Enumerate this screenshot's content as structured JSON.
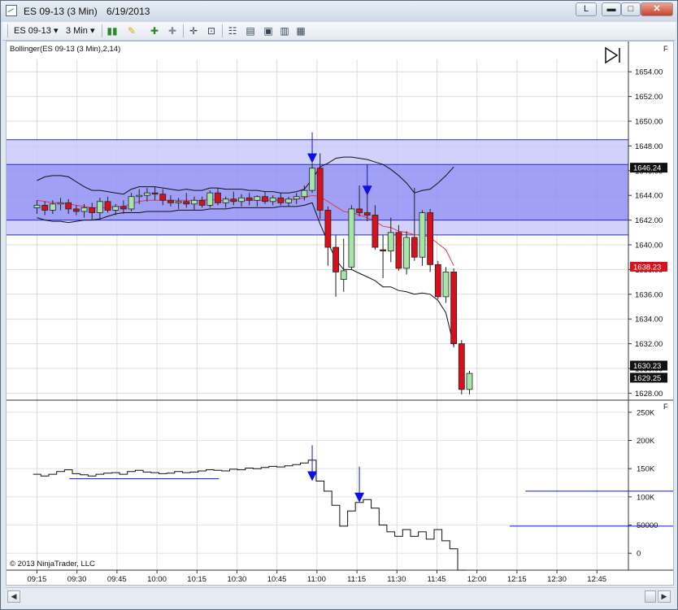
{
  "window": {
    "title_symbol": "ES 09-13 (3 Min)",
    "title_date": "6/19/2013",
    "btn_link": "L",
    "btn_min": "▬",
    "btn_max": "□",
    "btn_close": "✕"
  },
  "toolbar": {
    "instrument": "ES 09-13",
    "interval": "3 Min"
  },
  "chart": {
    "indicator_label": "Bollinger(ES 09-13 (3 Min),2,14)",
    "copyright": "© 2013 NinjaTrader, LLC",
    "colors": {
      "zone_fill": "#8f8ff5",
      "zone_fill_light": "#c9c9fb",
      "zone_line": "#2a2acf",
      "band": "#111111",
      "mid": "#e03a4a",
      "up": "#a8e3a8",
      "down": "#d8101c",
      "arrow": "#1010e0",
      "last_price_bg": "#d8101c",
      "marker_bg": "#111111"
    },
    "price_markers": [
      {
        "label": "1646.24",
        "value": 1646.24,
        "bg": "#111111"
      },
      {
        "label": "1638.23",
        "value": 1638.23,
        "bg": "#d8101c"
      },
      {
        "label": "1630.23",
        "value": 1630.23,
        "bg": "#111111"
      },
      {
        "label": "1629.25",
        "value": 1629.25,
        "bg": "#111111"
      }
    ]
  },
  "chart_data": {
    "type": "candlestick",
    "y_ticks": [
      "1654.00",
      "1652.00",
      "1650.00",
      "1648.00",
      "1646.00",
      "1644.00",
      "1642.00",
      "1640.00",
      "1638.00",
      "1636.00",
      "1634.00",
      "1632.00",
      "1630.00",
      "1628.00"
    ],
    "ylim": [
      1627.5,
      1655
    ],
    "x_ticks": [
      "09:15",
      "09:30",
      "09:45",
      "10:00",
      "10:15",
      "10:30",
      "10:45",
      "11:00",
      "11:15",
      "11:30",
      "11:45",
      "12:00",
      "12:15",
      "12:30",
      "12:45"
    ],
    "zones": [
      {
        "from": 1646.5,
        "to": 1648.5
      },
      {
        "from": 1642.0,
        "to": 1646.5,
        "dark": true
      },
      {
        "from": 1640.8,
        "to": 1642.0
      }
    ],
    "zone_lines": [
      1648.5,
      1646.5,
      1642.0,
      1640.8
    ],
    "candles": [
      {
        "o": 1643.0,
        "h": 1643.6,
        "l": 1642.5,
        "c": 1643.2
      },
      {
        "o": 1643.2,
        "h": 1643.5,
        "l": 1642.4,
        "c": 1642.8
      },
      {
        "o": 1642.8,
        "h": 1643.6,
        "l": 1642.5,
        "c": 1643.3
      },
      {
        "o": 1643.3,
        "h": 1643.8,
        "l": 1642.8,
        "c": 1643.4
      },
      {
        "o": 1643.4,
        "h": 1643.7,
        "l": 1642.5,
        "c": 1642.9
      },
      {
        "o": 1642.9,
        "h": 1643.2,
        "l": 1642.4,
        "c": 1642.7
      },
      {
        "o": 1642.7,
        "h": 1643.3,
        "l": 1642.2,
        "c": 1643.0
      },
      {
        "o": 1643.0,
        "h": 1643.4,
        "l": 1642.0,
        "c": 1642.6
      },
      {
        "o": 1642.6,
        "h": 1643.8,
        "l": 1642.0,
        "c": 1643.5
      },
      {
        "o": 1643.5,
        "h": 1643.9,
        "l": 1642.6,
        "c": 1642.8
      },
      {
        "o": 1642.8,
        "h": 1643.3,
        "l": 1642.4,
        "c": 1643.1
      },
      {
        "o": 1643.1,
        "h": 1643.6,
        "l": 1642.5,
        "c": 1642.9
      },
      {
        "o": 1642.9,
        "h": 1644.2,
        "l": 1642.7,
        "c": 1643.9
      },
      {
        "o": 1643.9,
        "h": 1644.5,
        "l": 1643.3,
        "c": 1644.0
      },
      {
        "o": 1644.0,
        "h": 1644.6,
        "l": 1643.5,
        "c": 1644.2
      },
      {
        "o": 1644.2,
        "h": 1644.7,
        "l": 1643.6,
        "c": 1644.1
      },
      {
        "o": 1644.1,
        "h": 1644.5,
        "l": 1643.2,
        "c": 1643.6
      },
      {
        "o": 1643.6,
        "h": 1644.0,
        "l": 1643.1,
        "c": 1643.4
      },
      {
        "o": 1643.4,
        "h": 1643.8,
        "l": 1642.9,
        "c": 1643.5
      },
      {
        "o": 1643.5,
        "h": 1644.2,
        "l": 1643.0,
        "c": 1643.3
      },
      {
        "o": 1643.3,
        "h": 1643.9,
        "l": 1642.8,
        "c": 1643.6
      },
      {
        "o": 1643.6,
        "h": 1643.9,
        "l": 1643.0,
        "c": 1643.2
      },
      {
        "o": 1643.2,
        "h": 1644.4,
        "l": 1643.0,
        "c": 1644.2
      },
      {
        "o": 1644.2,
        "h": 1644.6,
        "l": 1643.2,
        "c": 1643.4
      },
      {
        "o": 1643.4,
        "h": 1643.9,
        "l": 1643.0,
        "c": 1643.7
      },
      {
        "o": 1643.7,
        "h": 1644.3,
        "l": 1643.2,
        "c": 1643.5
      },
      {
        "o": 1643.5,
        "h": 1644.1,
        "l": 1643.1,
        "c": 1643.8
      },
      {
        "o": 1643.8,
        "h": 1644.2,
        "l": 1643.2,
        "c": 1643.6
      },
      {
        "o": 1643.6,
        "h": 1644.0,
        "l": 1643.1,
        "c": 1643.9
      },
      {
        "o": 1643.9,
        "h": 1644.3,
        "l": 1643.3,
        "c": 1643.5
      },
      {
        "o": 1643.5,
        "h": 1644.0,
        "l": 1643.2,
        "c": 1643.8
      },
      {
        "o": 1643.8,
        "h": 1644.2,
        "l": 1643.2,
        "c": 1643.4
      },
      {
        "o": 1643.4,
        "h": 1643.9,
        "l": 1643.1,
        "c": 1643.7
      },
      {
        "o": 1643.7,
        "h": 1644.2,
        "l": 1643.3,
        "c": 1643.9
      },
      {
        "o": 1643.9,
        "h": 1644.8,
        "l": 1643.6,
        "c": 1644.4
      },
      {
        "o": 1644.4,
        "h": 1646.6,
        "l": 1644.2,
        "c": 1646.2
      },
      {
        "o": 1646.2,
        "h": 1647.4,
        "l": 1642.1,
        "c": 1642.8
      },
      {
        "o": 1642.8,
        "h": 1643.1,
        "l": 1638.3,
        "c": 1639.8
      },
      {
        "o": 1639.8,
        "h": 1640.8,
        "l": 1635.8,
        "c": 1637.8
      },
      {
        "o": 1637.2,
        "h": 1640.5,
        "l": 1636.2,
        "c": 1637.9
      },
      {
        "o": 1638.2,
        "h": 1643.2,
        "l": 1638.0,
        "c": 1642.9
      },
      {
        "o": 1642.9,
        "h": 1644.8,
        "l": 1642.3,
        "c": 1642.6
      },
      {
        "o": 1642.6,
        "h": 1644.3,
        "l": 1641.9,
        "c": 1642.4
      },
      {
        "o": 1642.4,
        "h": 1643.2,
        "l": 1639.6,
        "c": 1639.8
      },
      {
        "o": 1639.6,
        "h": 1640.8,
        "l": 1637.3,
        "c": 1639.5
      },
      {
        "o": 1639.5,
        "h": 1642.2,
        "l": 1638.6,
        "c": 1641.0
      },
      {
        "o": 1641.0,
        "h": 1641.6,
        "l": 1637.9,
        "c": 1638.1
      },
      {
        "o": 1638.1,
        "h": 1641.1,
        "l": 1637.6,
        "c": 1640.6
      },
      {
        "o": 1640.6,
        "h": 1644.6,
        "l": 1638.7,
        "c": 1639.0
      },
      {
        "o": 1639.0,
        "h": 1642.8,
        "l": 1638.3,
        "c": 1642.6
      },
      {
        "o": 1642.6,
        "h": 1642.9,
        "l": 1637.8,
        "c": 1638.4
      },
      {
        "o": 1638.4,
        "h": 1638.7,
        "l": 1635.6,
        "c": 1635.8
      },
      {
        "o": 1635.8,
        "h": 1638.2,
        "l": 1635.3,
        "c": 1637.8
      },
      {
        "o": 1637.8,
        "h": 1638.1,
        "l": 1631.7,
        "c": 1632.0
      },
      {
        "o": 1632.0,
        "h": 1632.3,
        "l": 1627.9,
        "c": 1628.3
      },
      {
        "o": 1628.3,
        "h": 1629.8,
        "l": 1627.9,
        "c": 1629.6
      }
    ],
    "upper_band": [
      1645.2,
      1645.5,
      1645.6,
      1645.6,
      1645.5,
      1645.1,
      1644.7,
      1644.4,
      1644.4,
      1644.3,
      1644.2,
      1644.1,
      1644.5,
      1644.7,
      1644.7,
      1644.7,
      1644.6,
      1644.5,
      1644.4,
      1644.5,
      1644.4,
      1644.4,
      1644.6,
      1644.6,
      1644.5,
      1644.5,
      1644.5,
      1644.4,
      1644.4,
      1644.3,
      1644.3,
      1644.2,
      1644.2,
      1644.3,
      1644.5,
      1645.3,
      1646.3,
      1646.6,
      1647.0,
      1647.1,
      1647.1,
      1647.0,
      1646.9,
      1646.7,
      1646.5,
      1646.1,
      1645.6,
      1645.0,
      1644.2,
      1644.4,
      1644.5,
      1645.0,
      1645.6,
      1646.3
    ],
    "mid_band": [
      1643.6,
      1643.5,
      1643.4,
      1643.4,
      1643.3,
      1643.2,
      1643.1,
      1643.0,
      1643.0,
      1643.0,
      1643.1,
      1643.1,
      1643.3,
      1643.5,
      1643.6,
      1643.6,
      1643.6,
      1643.6,
      1643.6,
      1643.6,
      1643.6,
      1643.6,
      1643.7,
      1643.6,
      1643.6,
      1643.6,
      1643.6,
      1643.6,
      1643.6,
      1643.6,
      1643.6,
      1643.6,
      1643.6,
      1643.7,
      1643.8,
      1644.0,
      1643.9,
      1643.5,
      1643.1,
      1642.7,
      1642.6,
      1642.4,
      1642.2,
      1641.9,
      1641.5,
      1641.4,
      1641.1,
      1641.0,
      1640.8,
      1640.8,
      1640.6,
      1640.1,
      1639.6,
      1638.3
    ],
    "lower_band": [
      1642.2,
      1642.0,
      1641.9,
      1641.9,
      1641.8,
      1641.9,
      1642.0,
      1642.0,
      1642.1,
      1642.3,
      1642.5,
      1642.6,
      1642.6,
      1642.6,
      1642.7,
      1642.7,
      1642.7,
      1642.7,
      1642.8,
      1642.8,
      1642.8,
      1642.8,
      1642.9,
      1642.9,
      1642.9,
      1643.0,
      1643.0,
      1643.0,
      1643.0,
      1643.0,
      1643.0,
      1643.1,
      1643.1,
      1643.1,
      1643.2,
      1643.4,
      1641.7,
      1640.2,
      1638.8,
      1638.0,
      1638.0,
      1637.7,
      1637.4,
      1637.1,
      1636.6,
      1636.6,
      1636.3,
      1636.2,
      1636.0,
      1636.1,
      1636.0,
      1635.5,
      1634.5,
      1631.8
    ],
    "arrows_price": [
      {
        "i": 35,
        "value": 1646.6
      },
      {
        "i": 42,
        "value": 1644.0
      }
    ],
    "volume": {
      "y_ticks": [
        "250K",
        "200K",
        "150K",
        "100K",
        "50000",
        "0"
      ],
      "ylim": [
        -30000,
        270000
      ],
      "values": [
        140000,
        137000,
        140000,
        145000,
        148000,
        141000,
        139000,
        137000,
        140000,
        142000,
        143000,
        140000,
        145000,
        147000,
        144000,
        143000,
        141000,
        142000,
        145000,
        143000,
        144000,
        146000,
        148000,
        147000,
        146000,
        149000,
        148000,
        151000,
        150000,
        152000,
        154000,
        153000,
        155000,
        157000,
        160000,
        165000,
        128000,
        110000,
        85000,
        48000,
        75000,
        90000,
        95000,
        80000,
        50000,
        38000,
        30000,
        42000,
        30000,
        38000,
        25000,
        42000,
        22000,
        8000,
        -30000
      ],
      "hlines": [
        {
          "from": 8,
          "to": 27,
          "value": 132000
        },
        {
          "from": 66,
          "to": 104,
          "value": 110000
        },
        {
          "from": 64,
          "to": 103,
          "value": 48000
        }
      ],
      "arrows": [
        {
          "i": 35,
          "value": 128000
        },
        {
          "i": 41,
          "value": 90000
        }
      ]
    }
  }
}
